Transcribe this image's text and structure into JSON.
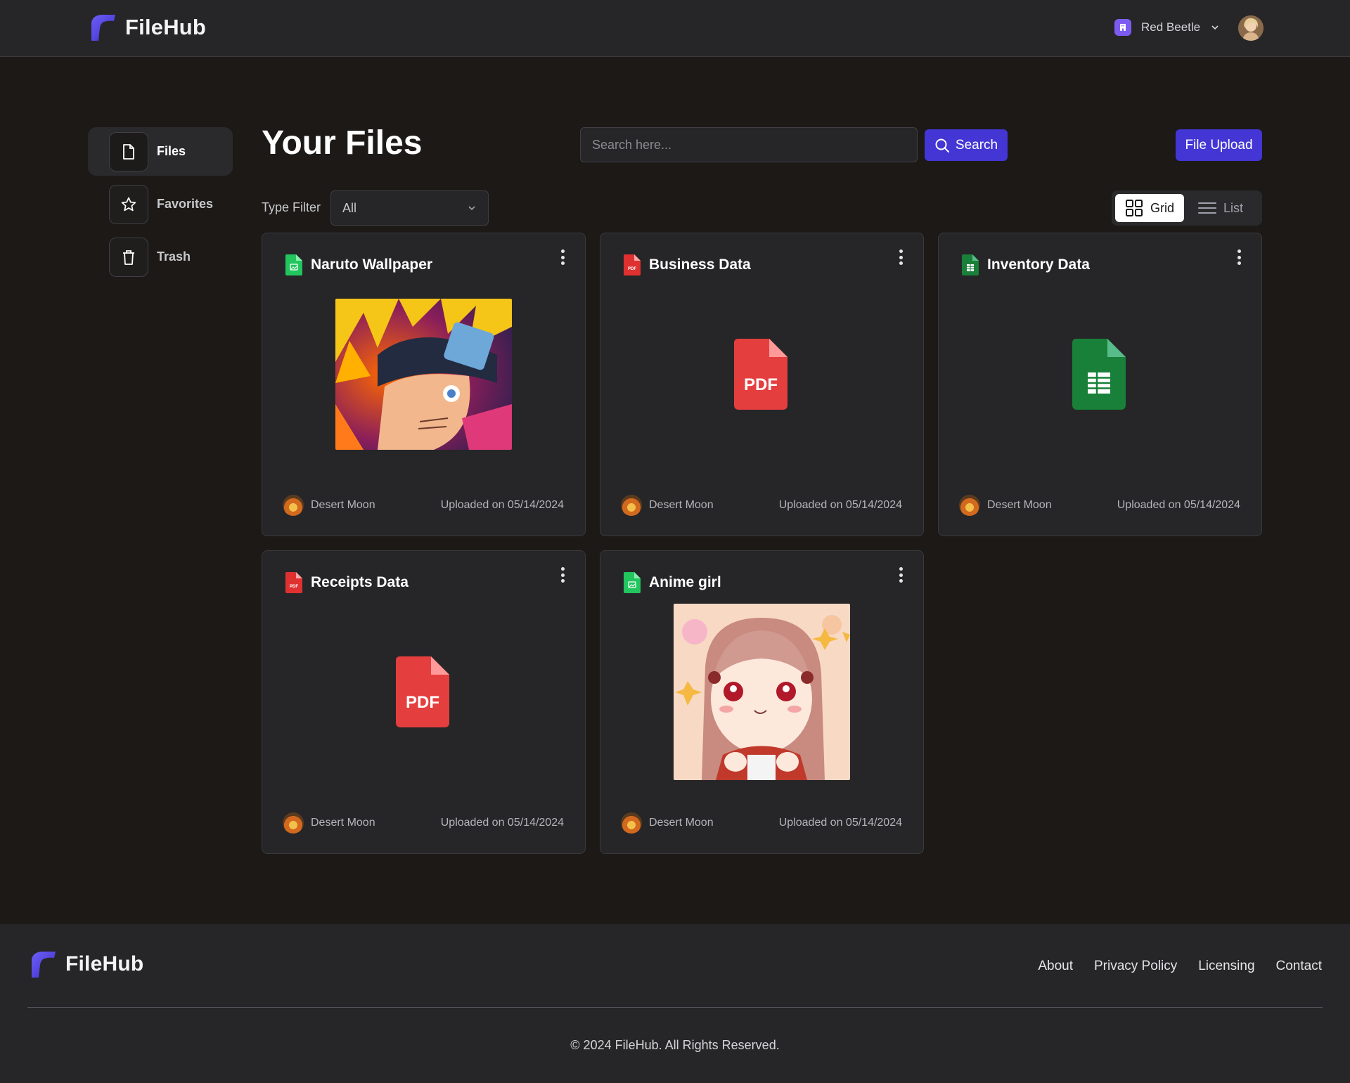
{
  "app": {
    "name": "FileHub"
  },
  "header": {
    "org_name": "Red Beetle",
    "user_avatar_alt": "user avatar"
  },
  "sidebar": {
    "items": [
      {
        "label": "Files",
        "icon": "file-icon",
        "active": true
      },
      {
        "label": "Favorites",
        "icon": "star-icon",
        "active": false
      },
      {
        "label": "Trash",
        "icon": "trash-icon",
        "active": false
      }
    ]
  },
  "main": {
    "title": "Your Files",
    "search": {
      "placeholder": "Search here...",
      "value": "",
      "button_label": "Search"
    },
    "upload_label": "File Upload",
    "type_filter": {
      "label": "Type Filter",
      "selected": "All"
    },
    "view_toggle": {
      "grid_label": "Grid",
      "list_label": "List",
      "active": "grid"
    }
  },
  "files": [
    {
      "title": "Naruto Wallpaper",
      "type": "image",
      "owner": "Desert Moon",
      "uploaded": "Uploaded on 05/14/2024"
    },
    {
      "title": "Business Data",
      "type": "pdf",
      "owner": "Desert Moon",
      "uploaded": "Uploaded on 05/14/2024"
    },
    {
      "title": "Inventory Data",
      "type": "csv",
      "owner": "Desert Moon",
      "uploaded": "Uploaded on 05/14/2024"
    },
    {
      "title": "Receipts Data",
      "type": "pdf",
      "owner": "Desert Moon",
      "uploaded": "Uploaded on 05/14/2024"
    },
    {
      "title": "Anime girl",
      "type": "image",
      "owner": "Desert Moon",
      "uploaded": "Uploaded on 05/14/2024"
    }
  ],
  "pdf_badge_text": "PDF",
  "footer": {
    "brand": "FileHub",
    "links": [
      "About",
      "Privacy Policy",
      "Licensing",
      "Contact"
    ],
    "copyright": "© 2024 FileHub. All Rights Reserved."
  },
  "colors": {
    "background": "#1c1917",
    "surface": "#262628",
    "accent": "#4336d4",
    "pdf_red": "#e03131",
    "sheet_green": "#137333",
    "image_green": "#22c55e"
  }
}
